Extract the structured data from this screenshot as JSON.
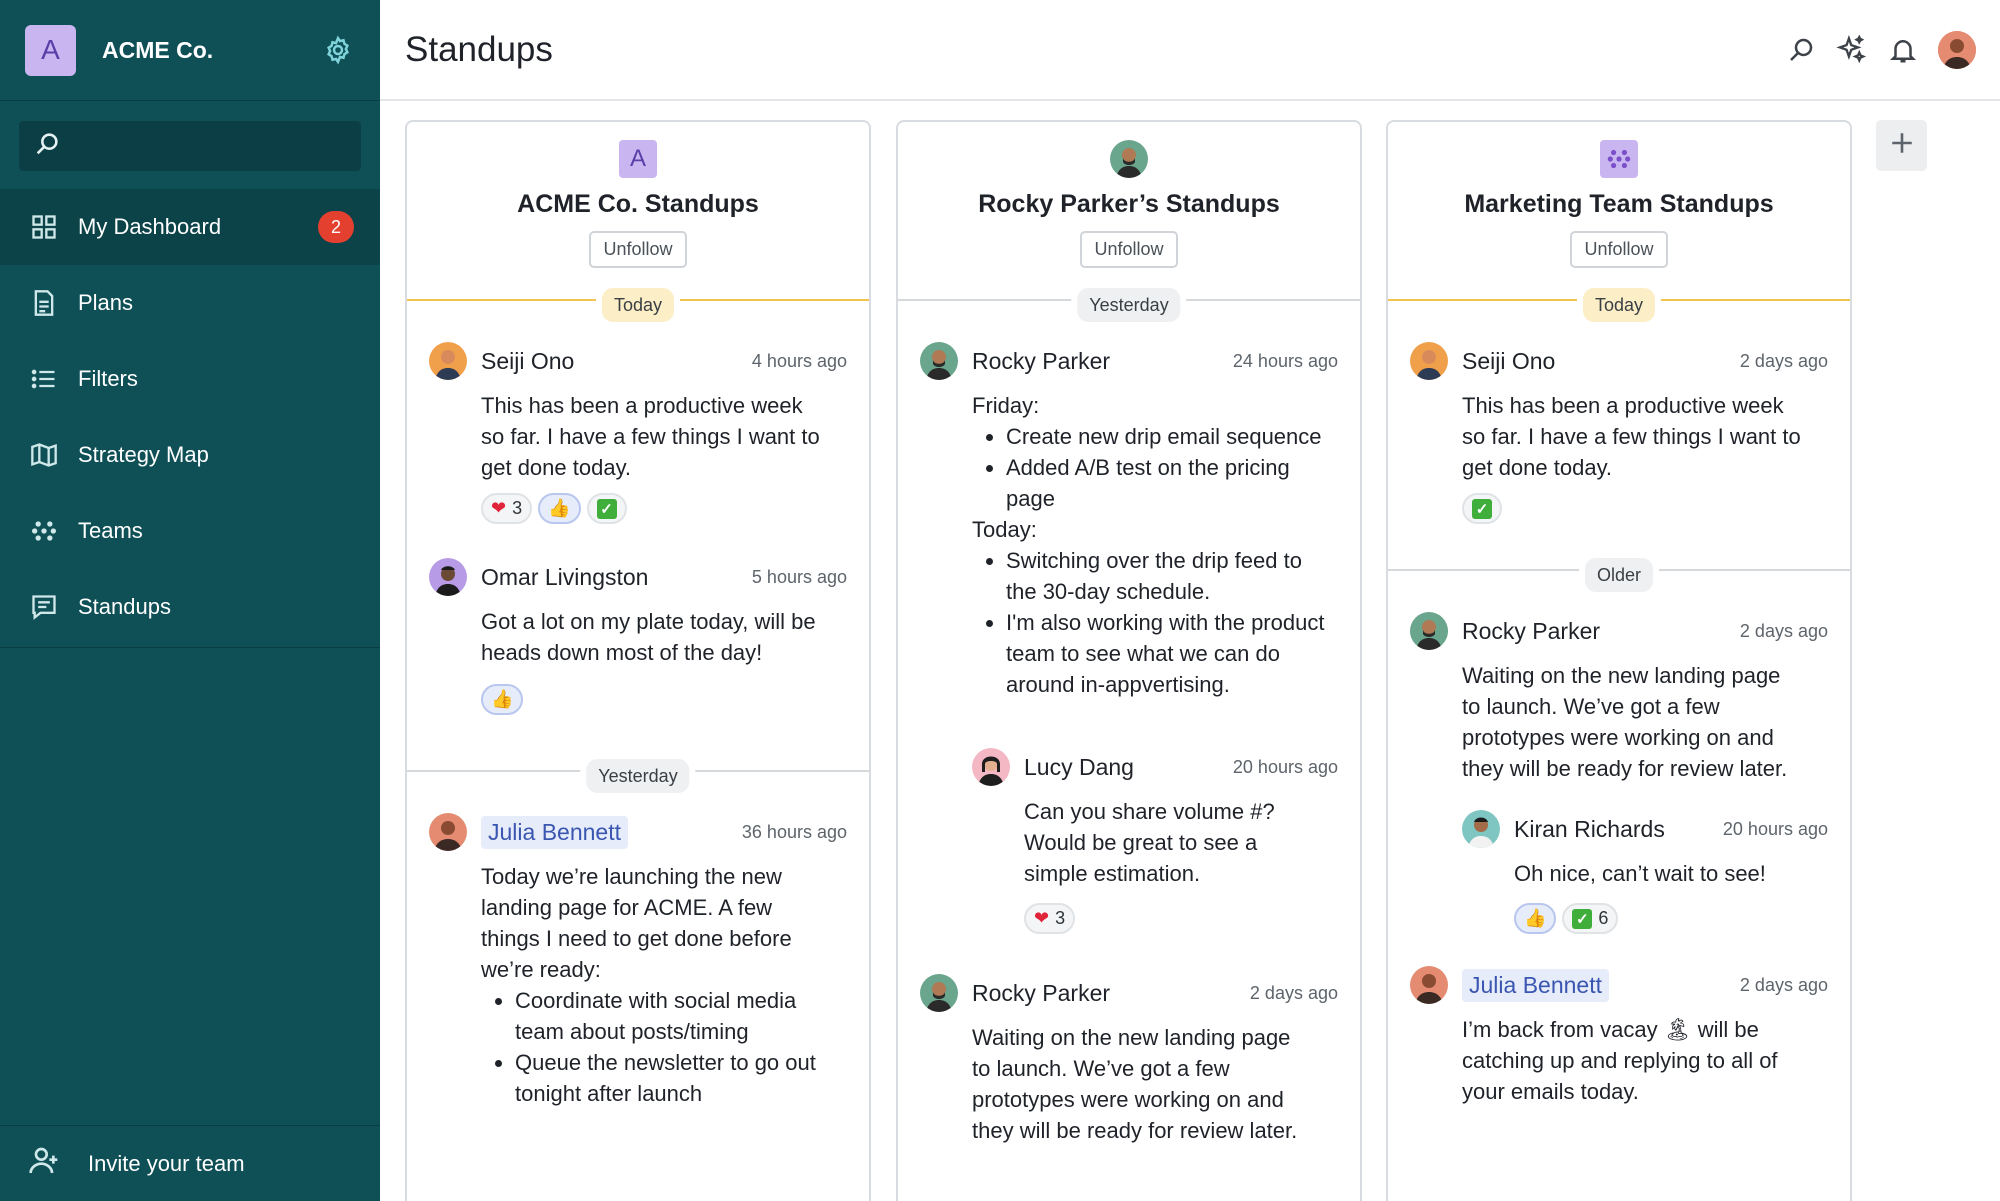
{
  "sidebar": {
    "org_initial": "A",
    "org_name": "ACME Co.",
    "search_placeholder": "",
    "items": [
      {
        "label": "My Dashboard",
        "icon": "grid-icon",
        "badge": "2",
        "active": true
      },
      {
        "label": "Plans",
        "icon": "document-icon"
      },
      {
        "label": "Filters",
        "icon": "list-icon"
      },
      {
        "label": "Strategy Map",
        "icon": "map-icon"
      },
      {
        "label": "Teams",
        "icon": "team-dots-icon"
      },
      {
        "label": "Standups",
        "icon": "chat-icon"
      }
    ],
    "invite_label": "Invite your team"
  },
  "header": {
    "title": "Standups"
  },
  "columns": [
    {
      "avatar": "A",
      "title": "ACME Co. Standups",
      "unfollow": "Unfollow",
      "sections": [
        {
          "label": "Today"
        },
        {
          "label": "Yesterday"
        }
      ],
      "posts": [
        {
          "author": "Seiji Ono",
          "time": "4 hours ago",
          "lines": [
            "This has been a productive week",
            "so far. I have a few things I want to",
            "get done today."
          ],
          "reactions": [
            {
              "emoji": "heart",
              "count": "3"
            },
            {
              "emoji": "thumbs-up",
              "count": ""
            },
            {
              "emoji": "check",
              "count": ""
            }
          ]
        },
        {
          "author": "Omar Livingston",
          "time": "5 hours ago",
          "lines": [
            "Got a lot on my plate today, will be",
            "heads down most of the day!"
          ],
          "reactions": [
            {
              "emoji": "thumbs-up",
              "count": ""
            }
          ]
        },
        {
          "author": "Julia Bennett",
          "time": "36 hours ago",
          "lines": [
            "Today we’re launching the new",
            "landing page for ACME. A few",
            "things I need to get done before",
            "we’re ready:"
          ],
          "bullets": [
            "Coordinate with social media team about posts/timing",
            "Queue the newsletter to go out tonight after launch"
          ]
        }
      ]
    },
    {
      "avatar": "",
      "title": "Rocky Parker’s Standups",
      "unfollow": "Unfollow",
      "sections": [
        {
          "label": "Yesterday"
        }
      ],
      "posts": [
        {
          "author": "Rocky Parker",
          "time": "24 hours ago",
          "friday": "Friday:",
          "friday_bullets": [
            "Create new drip email sequence",
            "Added A/B test on the pricing page"
          ],
          "today": "Today:",
          "today_bullets": [
            "Switching over the drip feed to the 30-day schedule.",
            "I'm also working with the product team to see what we can do around in-appvertising."
          ]
        },
        {
          "author": "Lucy Dang",
          "time": "20 hours ago",
          "lines": [
            "Can you share volume #?",
            "Would be great to see a",
            "simple estimation."
          ],
          "reactions": [
            {
              "emoji": "heart",
              "count": "3"
            }
          ]
        },
        {
          "author": "Rocky Parker",
          "time": "2 days ago",
          "lines": [
            "Waiting on the new landing page",
            "to launch. We’ve got a few",
            "prototypes were working on and",
            "they will be ready for review later."
          ]
        }
      ]
    },
    {
      "avatar": "",
      "title": "Marketing Team Standups",
      "unfollow": "Unfollow",
      "sections": [
        {
          "label": "Today"
        },
        {
          "label": "Older"
        }
      ],
      "posts": [
        {
          "author": "Seiji Ono",
          "time": "2 days ago",
          "lines": [
            "This has been a productive week",
            "so far. I have a few things I want to",
            "get done today."
          ],
          "reactions": [
            {
              "emoji": "check",
              "count": ""
            }
          ]
        },
        {
          "author": "Rocky Parker",
          "time": "2 days ago",
          "lines": [
            "Waiting on the new landing page",
            "to launch. We’ve got a few",
            "prototypes were working on and",
            "they will be ready for review later."
          ]
        },
        {
          "author": "Kiran Richards",
          "time": "20 hours ago",
          "lines": [
            "Oh nice, can’t wait to see!"
          ],
          "reactions": [
            {
              "emoji": "thumbs-up",
              "count": ""
            },
            {
              "emoji": "check",
              "count": "6"
            }
          ]
        },
        {
          "author": "Julia Bennett",
          "time": "2 days ago",
          "lines": [
            "I’m back from vacay 🏝 will be",
            "catching up and replying to all of",
            "your emails today."
          ]
        }
      ]
    }
  ],
  "colors": {
    "sidebar_bg": "#0f5057",
    "today_accent": "#f1c44f",
    "badge": "#e4402f"
  }
}
